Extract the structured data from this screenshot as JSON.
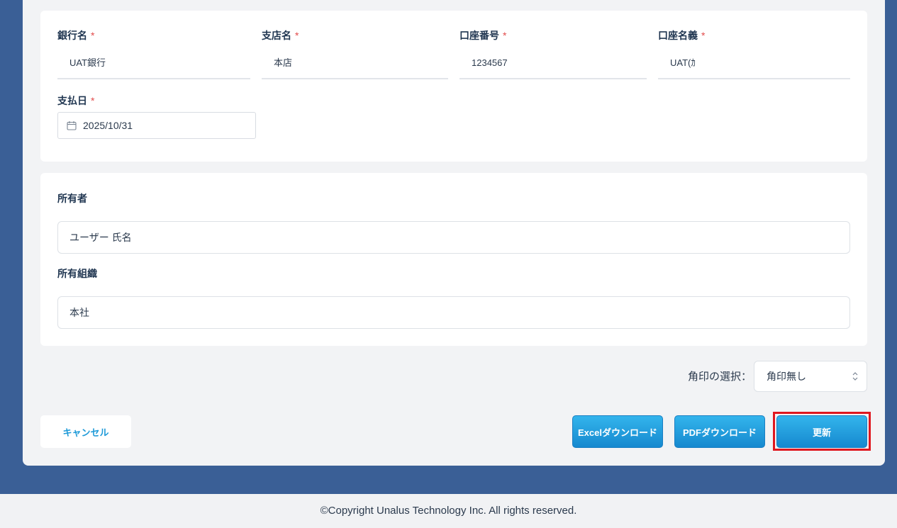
{
  "bank": {
    "bank_name": {
      "label": "銀行名",
      "required_mark": "*",
      "value": "UAT銀行"
    },
    "branch_name": {
      "label": "支店名",
      "required_mark": "*",
      "value": "本店"
    },
    "account_number": {
      "label": "口座番号",
      "required_mark": "*",
      "value": "1234567"
    },
    "account_holder": {
      "label": "口座名義",
      "required_mark": "*",
      "value": "UAT(ｶ"
    },
    "payment_date": {
      "label": "支払日",
      "required_mark": "*",
      "value": "2025/10/31"
    }
  },
  "owner": {
    "owner_label": "所有者",
    "owner_value": "ユーザー 氏名",
    "org_label": "所有組織",
    "org_value": "本社"
  },
  "stamp": {
    "label": "角印の選択：",
    "selected": "角印無し"
  },
  "actions": {
    "cancel": "キャンセル",
    "excel_download": "Excelダウンロード",
    "pdf_download": "PDFダウンロード",
    "update": "更新"
  },
  "footer": {
    "copyright": "©Copyright Unalus Technology Inc. All rights reserved."
  },
  "colors": {
    "background": "#3a5f96",
    "panel": "#f2f3f5",
    "accent": "#1e9ad8",
    "required": "#e24b4b",
    "highlight": "#e0171f"
  },
  "icons": {
    "date": "calendar-icon",
    "select": "chevron-updown-icon"
  }
}
